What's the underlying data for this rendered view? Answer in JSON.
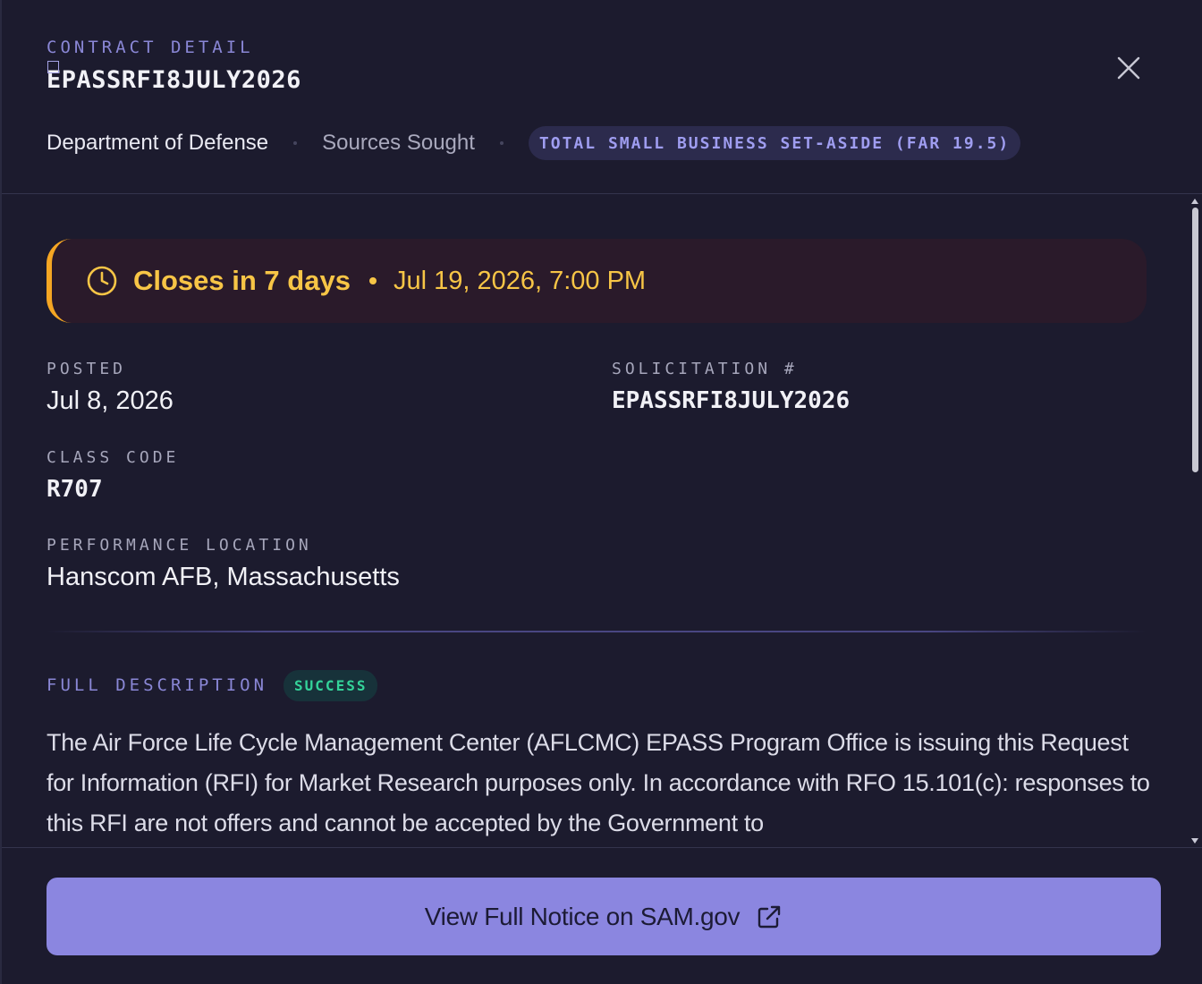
{
  "header": {
    "eyebrow": "CONTRACT DETAIL",
    "notice_id": "EPASSRFI8JULY2026",
    "agency": "Department of Defense",
    "notice_type": "Sources Sought",
    "set_aside": "TOTAL SMALL BUSINESS SET-ASIDE (FAR 19.5)",
    "close_icon": "close-icon"
  },
  "deadline": {
    "icon": "clock-icon",
    "closes": "Closes in 7 days",
    "date": "Jul 19, 2026, 7:00 PM",
    "accent_color": "#f7c546"
  },
  "fields": {
    "posted_label": "POSTED",
    "posted_value": "Jul 8, 2026",
    "solicitation_label": "SOLICITATION #",
    "solicitation_value": "EPASSRFI8JULY2026",
    "class_code_label": "CLASS CODE",
    "class_code_value": "R707",
    "location_label": "PERFORMANCE LOCATION",
    "location_value": "Hanscom AFB, Massachusetts"
  },
  "description": {
    "label": "FULL DESCRIPTION",
    "status_badge": "SUCCESS",
    "text": "The Air Force Life Cycle Management Center (AFLCMC) EPASS Program Office is issuing this Request for Information (RFI) for Market Research purposes only. In accordance with RFO 15.101(c): responses to this RFI are not offers and cannot be accepted by the Government to"
  },
  "footer": {
    "cta_label": "View Full Notice on SAM.gov",
    "cta_icon": "external-link-icon",
    "cta_color": "#8b86e0"
  },
  "colors": {
    "background": "#1c1b2e",
    "accent": "#8a87d6",
    "success": "#34d399",
    "warning": "#f7c546"
  }
}
